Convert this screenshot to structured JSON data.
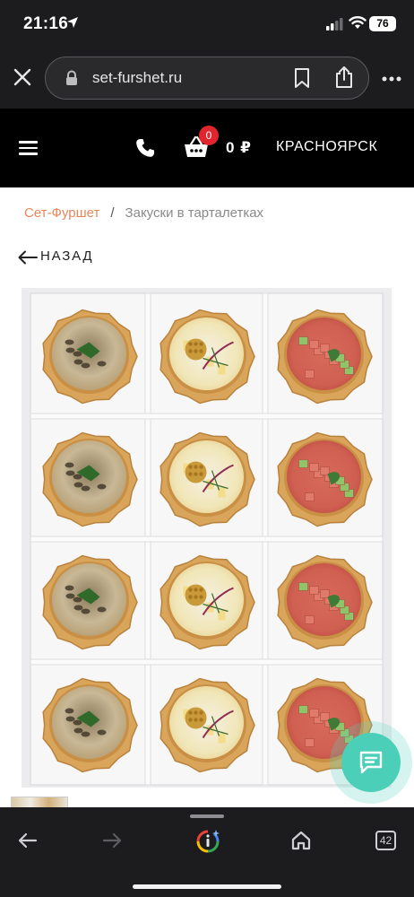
{
  "status_bar": {
    "time": "21:16",
    "battery": "76"
  },
  "browser": {
    "url": "set-furshet.ru",
    "tab_count": "42"
  },
  "site_header": {
    "cart_count": "0",
    "cart_total": "0 ₽",
    "city": "КРАСНОЯРСК"
  },
  "breadcrumb": {
    "home": "Сет-Фуршет",
    "separator": "/",
    "current": "Закуски в тарталетках"
  },
  "back_label": "НАЗАД",
  "product_image": {
    "columns": [
      {
        "filling": "mushroom",
        "count": 4
      },
      {
        "filling": "salad-with-mustard",
        "count": 4
      },
      {
        "filling": "ham-cucumber",
        "count": 4
      }
    ]
  },
  "colors": {
    "accent": "#e8875b",
    "chat": "#4ccfb8",
    "badge": "#e0262c"
  }
}
